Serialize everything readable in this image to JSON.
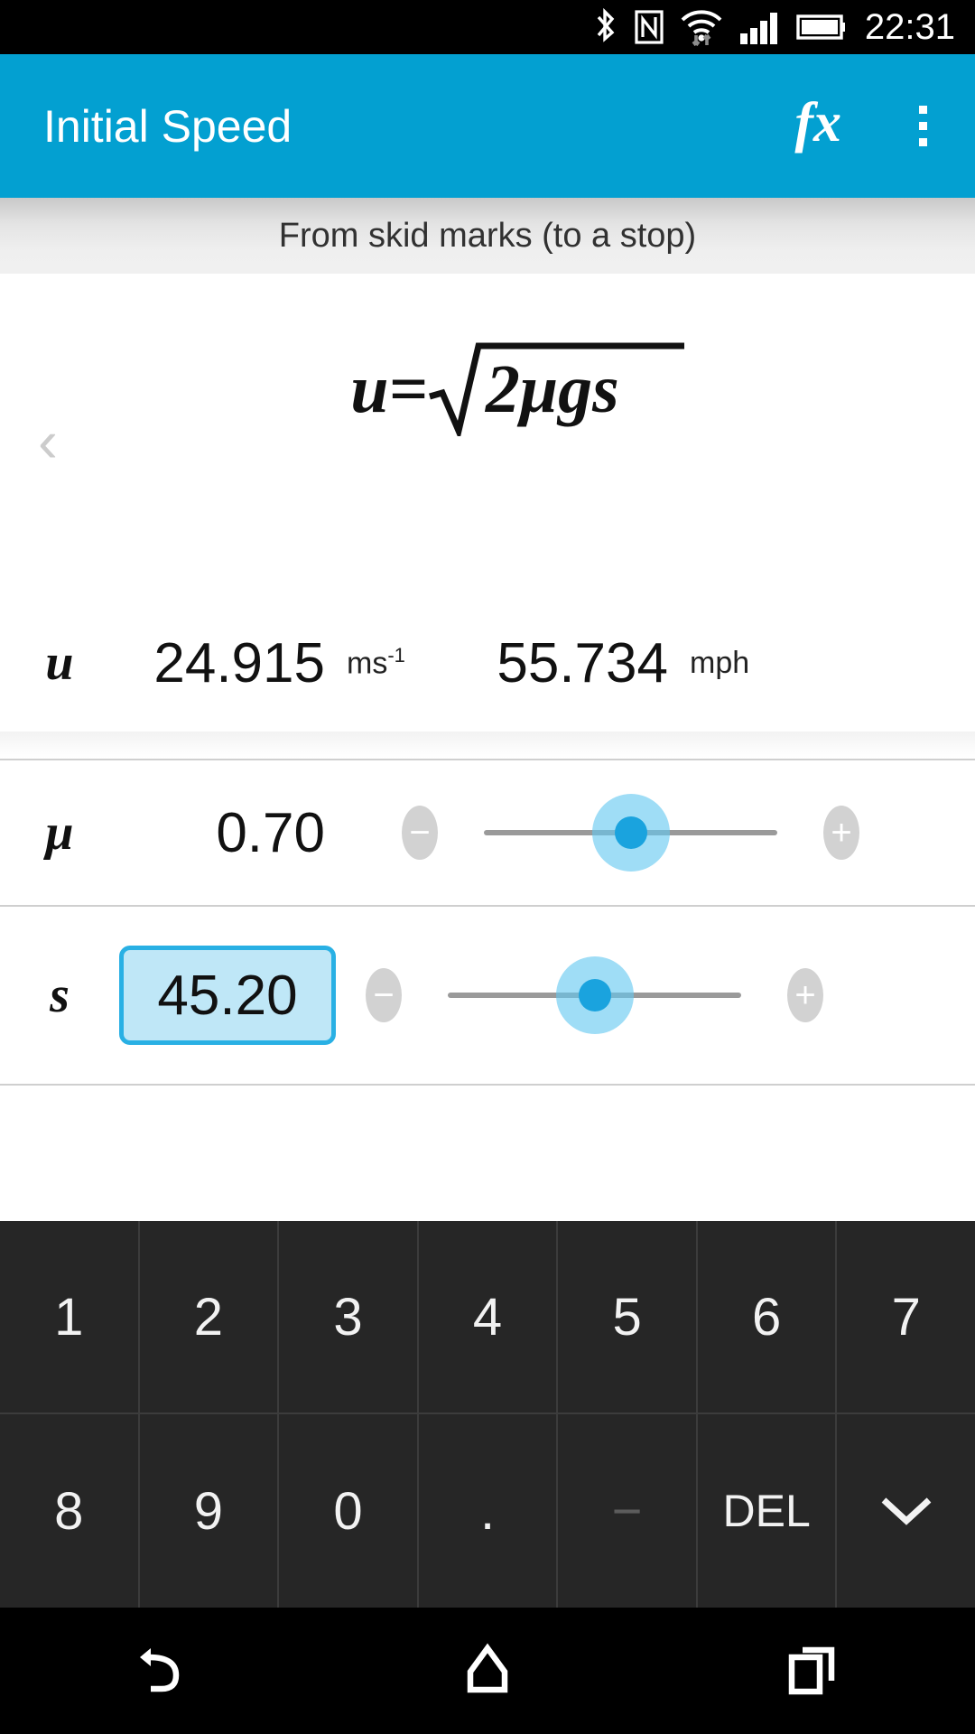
{
  "status_bar": {
    "time": "22:31",
    "icons": [
      "bluetooth-icon",
      "nfc-icon",
      "wifi-icon",
      "signal-icon",
      "battery-icon"
    ]
  },
  "app_bar": {
    "title": "Initial Speed",
    "fx_label": "fx",
    "overflow_label": "⋮"
  },
  "subtitle": "From skid marks (to a stop)",
  "formula": {
    "prev_arrow": "‹",
    "lhs": "u=",
    "radicand": "2μgs",
    "plain": "u=√(2μgs)"
  },
  "result_row": {
    "symbol": "u",
    "value_metric": "24.915",
    "unit_metric": "ms",
    "unit_metric_exp": "-1",
    "value_imperial": "55.734",
    "unit_imperial": "mph"
  },
  "input_rows": [
    {
      "symbol": "μ",
      "value": "0.70",
      "focused": false,
      "minus_label": "−",
      "plus_label": "+",
      "slider_percent": 50
    },
    {
      "symbol": "s",
      "value": "45.20",
      "focused": true,
      "minus_label": "−",
      "plus_label": "+",
      "slider_percent": 50
    }
  ],
  "keypad": {
    "row1": [
      {
        "label": "1",
        "name": "key-1",
        "state": "enabled"
      },
      {
        "label": "2",
        "name": "key-2",
        "state": "enabled"
      },
      {
        "label": "3",
        "name": "key-3",
        "state": "enabled"
      },
      {
        "label": "4",
        "name": "key-4",
        "state": "enabled"
      },
      {
        "label": "5",
        "name": "key-5",
        "state": "enabled"
      },
      {
        "label": "6",
        "name": "key-6",
        "state": "enabled"
      },
      {
        "label": "7",
        "name": "key-7",
        "state": "enabled"
      }
    ],
    "row2": [
      {
        "label": "8",
        "name": "key-8",
        "state": "enabled"
      },
      {
        "label": "9",
        "name": "key-9",
        "state": "enabled"
      },
      {
        "label": "0",
        "name": "key-0",
        "state": "enabled"
      },
      {
        "label": ".",
        "name": "key-decimal",
        "state": "enabled"
      },
      {
        "label": "−",
        "name": "key-minus",
        "state": "disabled"
      },
      {
        "label": "DEL",
        "name": "key-delete",
        "state": "enabled"
      },
      {
        "label": "",
        "name": "key-hide-keyboard",
        "state": "enabled"
      }
    ]
  },
  "nav_bar": {
    "back": "back-icon",
    "home": "home-icon",
    "recents": "recents-icon"
  },
  "colors": {
    "accent": "#03a0d1",
    "accent_light": "#bfe7f7",
    "field_border": "#29b0e4",
    "keypad_bg": "#262626",
    "status_bg": "#000000"
  }
}
